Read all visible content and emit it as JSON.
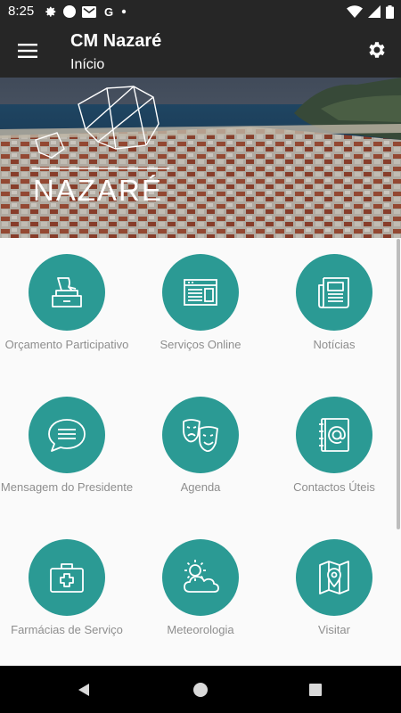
{
  "status_bar": {
    "time": "8:25",
    "left_icons": [
      "gear-icon",
      "circle-icon",
      "gmail-icon",
      "google-icon",
      "dot-icon"
    ],
    "right_icons": [
      "wifi-icon",
      "signal-icon",
      "battery-icon"
    ]
  },
  "app_bar": {
    "title": "CM Nazaré",
    "subtitle": "Início"
  },
  "hero": {
    "text": "NAZARÉ"
  },
  "grid": {
    "items": [
      {
        "label": "Orçamento Participativo",
        "icon": "ballot-box-icon"
      },
      {
        "label": "Serviços Online",
        "icon": "browser-window-icon"
      },
      {
        "label": "Notícias",
        "icon": "newspaper-icon"
      },
      {
        "label": "Mensagem do Presidente",
        "icon": "chat-bubble-icon"
      },
      {
        "label": "Agenda",
        "icon": "theater-masks-icon"
      },
      {
        "label": "Contactos Úteis",
        "icon": "address-book-icon"
      },
      {
        "label": "Farmácias de Serviço",
        "icon": "medical-kit-icon"
      },
      {
        "label": "Meteorologia",
        "icon": "weather-icon"
      },
      {
        "label": "Visitar",
        "icon": "map-pin-icon"
      }
    ]
  },
  "colors": {
    "bar": "#262626",
    "accent": "#2b9a94",
    "label": "#8e8e8e"
  }
}
